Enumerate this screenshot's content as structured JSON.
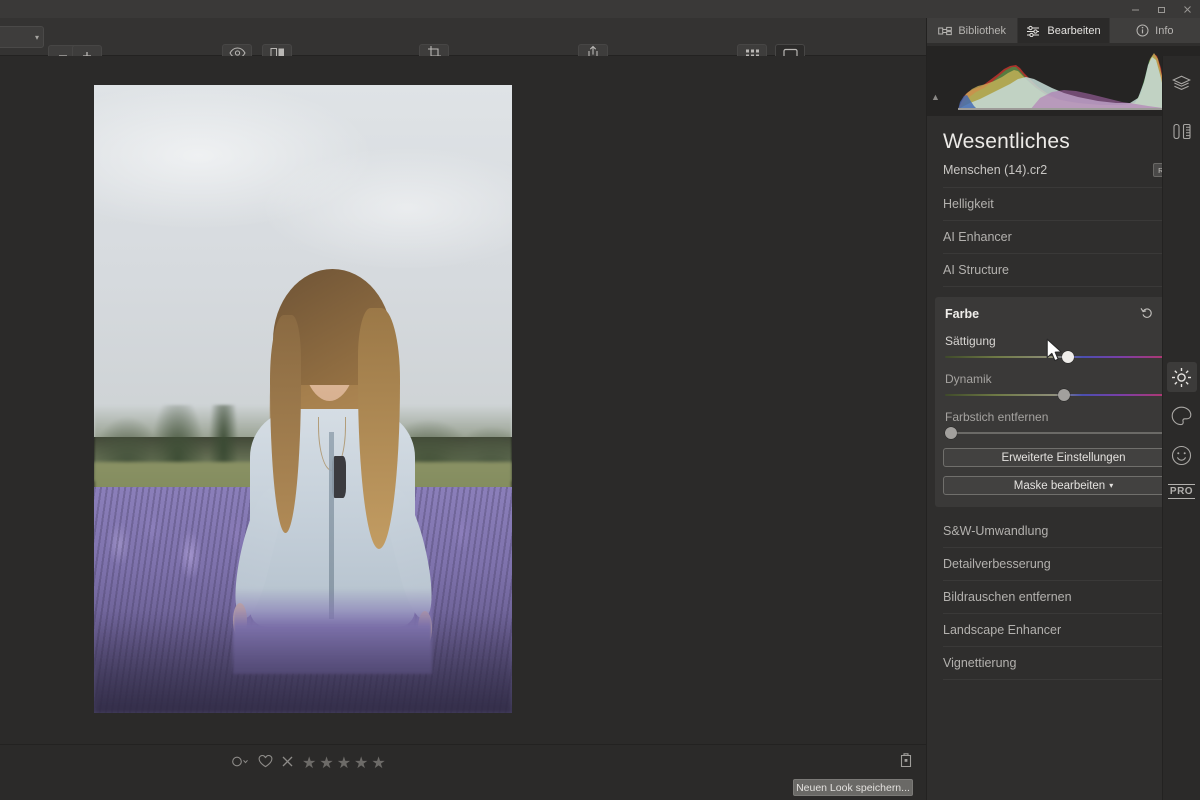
{
  "window": {
    "minimize_label": "Minimieren",
    "restore_label": "Wiederherstellen",
    "close_label": "Schließen"
  },
  "toolbar": {
    "zoom_value": "",
    "zoom_out_label": "–",
    "zoom_in_label": "+",
    "icons": {
      "preview": "eye-icon",
      "compare": "compare-split-icon",
      "crop": "crop-icon",
      "export": "share-export-icon",
      "grid": "grid-view-icon",
      "single": "single-view-icon"
    }
  },
  "canvas": {
    "background_color": "#2b2a29",
    "photo_alt": "Frau im Lavendelfeld"
  },
  "bottombar": {
    "color_label_icon": "color-label-dropdown-icon",
    "favorite_icon": "heart-icon",
    "reject_icon": "reject-x-icon",
    "stars": [
      "★",
      "★",
      "★",
      "★",
      "★"
    ],
    "star_count": 0,
    "trash_icon": "trash-icon",
    "save_look_label": "Neuen Look speichern..."
  },
  "panel": {
    "tabs": [
      {
        "label": "Bibliothek",
        "icon": "library-icon",
        "active": false
      },
      {
        "label": "Bearbeiten",
        "icon": "sliders-icon",
        "active": true
      },
      {
        "label": "Info",
        "icon": "info-icon",
        "active": false
      }
    ],
    "histogram": {
      "warn_left": "▲",
      "warn_right": "▲"
    },
    "title": "Wesentliches",
    "file_name": "Menschen (14).cr2",
    "file_badge": "RAW",
    "rows_above": [
      {
        "label": "Helligkeit"
      },
      {
        "label": "AI Enhancer"
      },
      {
        "label": "AI Structure"
      }
    ],
    "section": {
      "title": "Farbe",
      "reset_icon": "reset-arrow-icon",
      "toggle_icon": "visibility-toggle",
      "toggle_on": true,
      "sliders": [
        {
          "name": "Sättigung",
          "value": "2",
          "position_pct": 52,
          "type": "color",
          "active": true
        },
        {
          "name": "Dynamik",
          "value": "0",
          "position_pct": 50,
          "type": "color",
          "active": false
        },
        {
          "name": "Farbstich entfernen",
          "value": "0",
          "position_pct": 0,
          "type": "plain",
          "active": false
        }
      ],
      "buttons": [
        {
          "label": "Erweiterte Einstellungen",
          "caret": false
        },
        {
          "label": "Maske bearbeiten",
          "caret": true
        }
      ]
    },
    "rows_below": [
      {
        "label": "S&W-Umwandlung"
      },
      {
        "label": "Detailverbesserung"
      },
      {
        "label": "Bildrauschen entfernen"
      },
      {
        "label": "Landscape Enhancer"
      },
      {
        "label": "Vignettierung"
      }
    ]
  },
  "rail": {
    "icons": [
      {
        "name": "layers-icon",
        "active": false
      },
      {
        "name": "tools-icon",
        "active": false
      },
      {
        "name": "light-sun-icon",
        "active": true
      },
      {
        "name": "color-palette-icon",
        "active": false
      },
      {
        "name": "portrait-face-icon",
        "active": false
      }
    ],
    "pro_label": "PRO"
  },
  "colors": {
    "app_background": "#2b2a29",
    "panel_background": "#2f2e2d",
    "section_background": "#3a3938",
    "toolbar_background": "#343332",
    "text_primary": "#e4e2df",
    "text_secondary": "#b3b1ae"
  }
}
